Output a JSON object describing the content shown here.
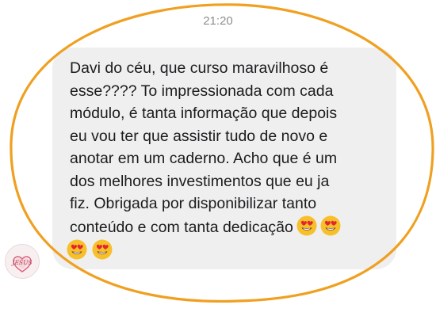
{
  "header": {
    "time": "21:20"
  },
  "message": {
    "text": "Davi do céu, que curso maravilhoso é\nesse???? To impressionada com cada\nmódulo, é tanta informação que depois\neu vou ter que assistir tudo de novo e\nanotar em um caderno. Acho que é um\ndos melhores investimentos que eu ja\nfiz. Obrigada por disponibilizar tanto\nconteúdo e com tanta dedicação",
    "emojis_inline": [
      "heart-eyes-emoji",
      "heart-eyes-emoji"
    ],
    "emojis_next_line": [
      "heart-eyes-emoji",
      "heart-eyes-emoji"
    ]
  },
  "sender": {
    "avatar_text": "JESUS",
    "avatar_icon": "heart-avatar"
  },
  "colors": {
    "bubble": "#efeff0",
    "text": "#1c1c1e",
    "timestamp": "#8e8e93",
    "highlight_ellipse": "#f0a020"
  }
}
